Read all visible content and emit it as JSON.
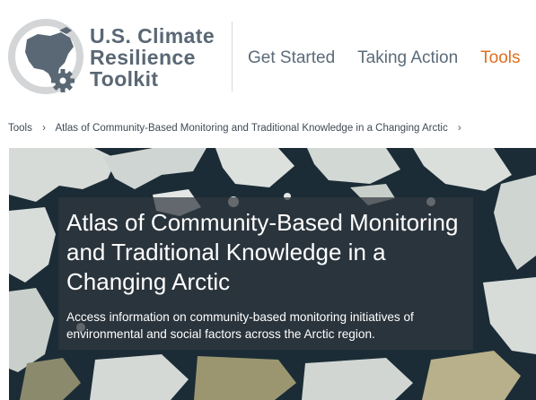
{
  "logo": {
    "line1": "U.S. Climate",
    "line2": "Resilience",
    "line3": "Toolkit",
    "icon": "north-america-gear-icon"
  },
  "nav": {
    "items": [
      {
        "label": "Get Started"
      },
      {
        "label": "Taking Action"
      },
      {
        "label": "Tools"
      }
    ]
  },
  "breadcrumb": {
    "items": [
      {
        "label": "Tools"
      },
      {
        "label": "Atlas of Community-Based Monitoring and Traditional Knowledge in a Changing Arctic"
      }
    ],
    "separator": "›"
  },
  "hero": {
    "title": "Atlas of Community-Based Monitoring and Traditional Knowledge in a Changing Arctic",
    "description": "Access information on community-based monitoring initiatives of environmental and social factors across the Arctic region."
  },
  "colors": {
    "brand_gray": "#5a6774",
    "nav_active": "#e16f20",
    "nav_text": "#5b6b7a"
  }
}
